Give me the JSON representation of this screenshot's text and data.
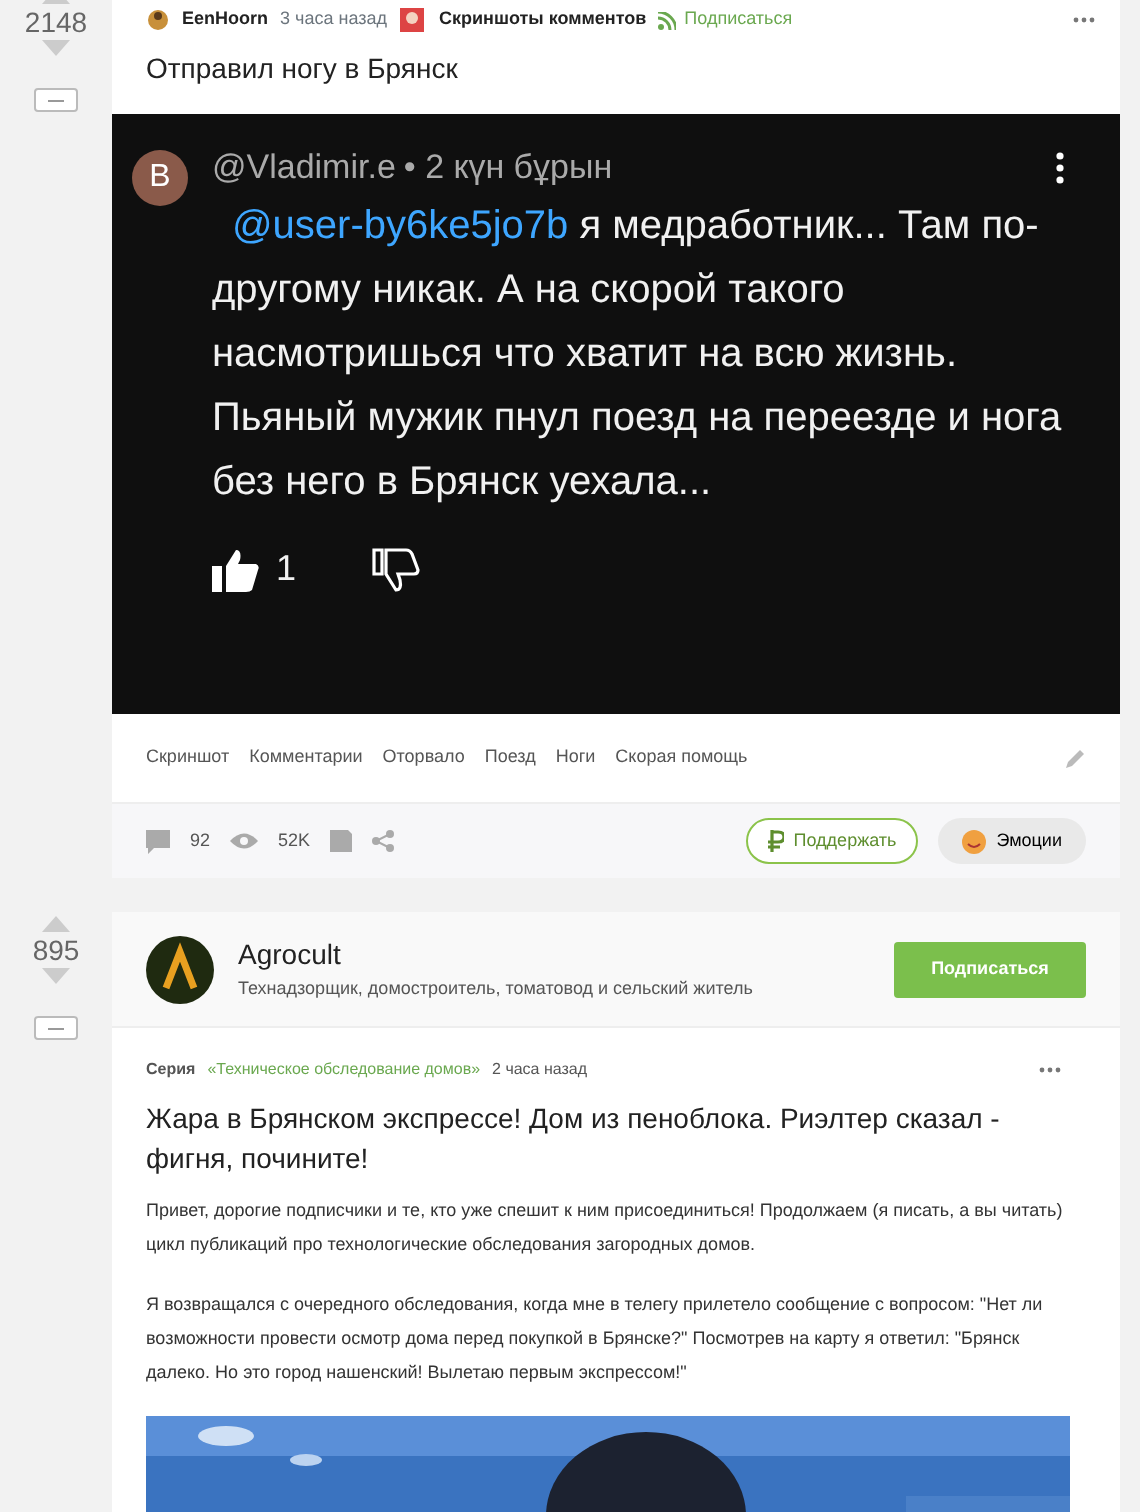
{
  "first_post": {
    "rating": "2148",
    "author": "EenHoorn",
    "time": "3 часа назад",
    "community": "Скриншоты комментов",
    "subscribe": "Подписаться",
    "title": "Отправил ногу в Брянск",
    "screenshot": {
      "avatar_letter": "B",
      "user": "@Vladimir.e",
      "time": "• 2 күн бұрын",
      "mention": "@user-by6ke5jo7b",
      "text": " я медработник... Там по-другому никак. А на скорой такого насмотришься что  хватит на всю жизнь. Пьяный мужик пнул поезд на переезде и нога без него в Брянск уехала...",
      "likes": "1"
    },
    "tags": [
      "Скриншот",
      "Комментарии",
      "Оторвало",
      "Поезд",
      "Ноги",
      "Скорая помощь"
    ],
    "comments": "92",
    "views": "52K",
    "donate": "Поддержать",
    "emotions": "Эмоции"
  },
  "second_post": {
    "rating": "895",
    "author": "Agrocult",
    "author_bio": "Технадзорщик, домостроитель, томатовод и сельский житель",
    "subscribe": "Подписаться",
    "series_label": "Серия",
    "series": "«Техническое обследование домов»",
    "time": "2 часа назад",
    "title": "Жара в Брянском экспрессе! Дом из пеноблока. Риэлтер сказал - фигня, почините!",
    "paragraphs": [
      "Привет, дорогие подписчики и те, кто уже спешит к ним присоединиться! Продолжаем (я писать, а вы читать) цикл публикаций про технологические обследования загородных домов.",
      "Я возвращался с очередного обследования, когда мне в телегу прилетело сообщение с вопросом: \"Нет ли возможности провести осмотр дома перед покупкой в Брянске?\" Посмотрев на карту я ответил: \"Брянск далеко. Но это город нашенский! Вылетаю первым экспрессом!\""
    ]
  }
}
